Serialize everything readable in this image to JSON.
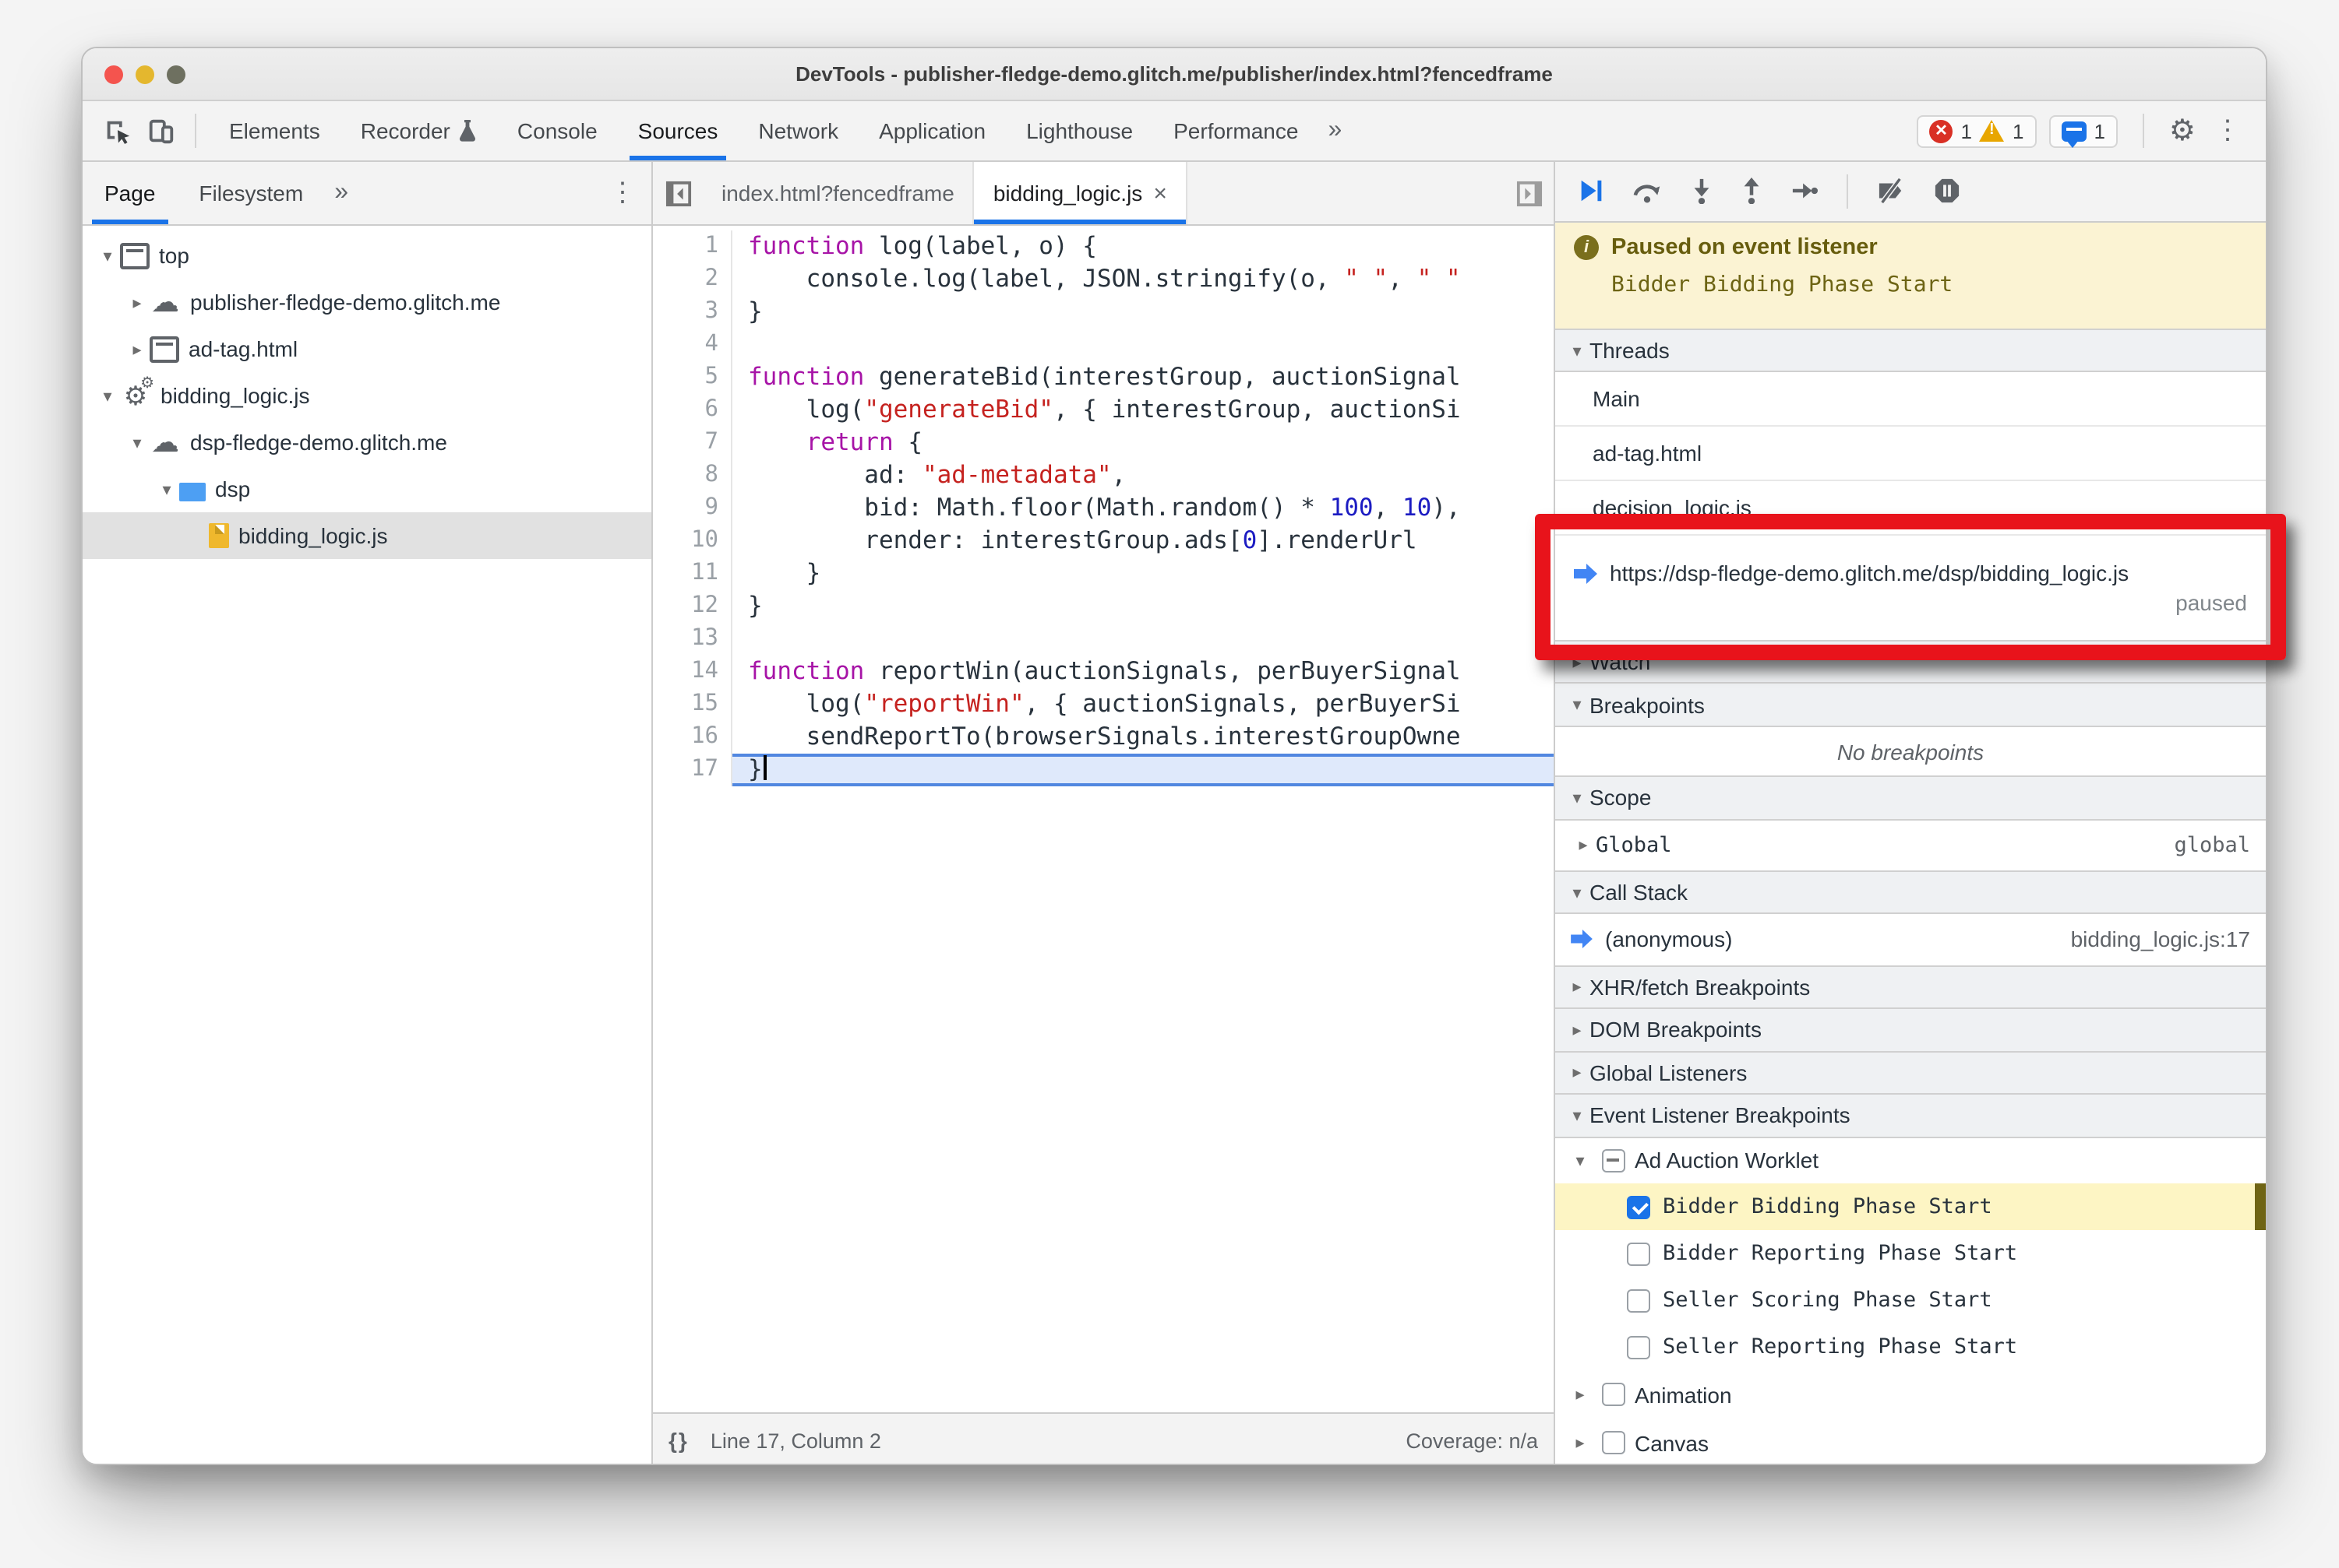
{
  "window": {
    "title": "DevTools - publisher-fledge-demo.glitch.me/publisher/index.html?fencedframe"
  },
  "toolbar": {
    "selected": "Sources",
    "tabs": [
      {
        "label": "Elements"
      },
      {
        "label": "Recorder",
        "icon": "flask"
      },
      {
        "label": "Console"
      },
      {
        "label": "Sources"
      },
      {
        "label": "Network"
      },
      {
        "label": "Application"
      },
      {
        "label": "Lighthouse"
      },
      {
        "label": "Performance"
      }
    ],
    "overflow": "»",
    "badges": {
      "errors": "1",
      "warnings": "1",
      "messages": "1"
    },
    "kebab": "⋮"
  },
  "navigator": {
    "tabs": [
      {
        "label": "Page"
      },
      {
        "label": "Filesystem"
      }
    ],
    "selected": "Page",
    "overflow": "»",
    "kebab": "⋮",
    "tree": [
      {
        "indent": 0,
        "disclosure": "down",
        "icon": "frame",
        "label": "top"
      },
      {
        "indent": 1,
        "disclosure": "right",
        "icon": "cloud",
        "label": "publisher-fledge-demo.glitch.me"
      },
      {
        "indent": 1,
        "disclosure": "right",
        "icon": "frame",
        "label": "ad-tag.html"
      },
      {
        "indent": 0,
        "disclosure": "down",
        "icon": "gears",
        "label": "bidding_logic.js"
      },
      {
        "indent": 1,
        "disclosure": "down",
        "icon": "cloud",
        "label": "dsp-fledge-demo.glitch.me"
      },
      {
        "indent": 2,
        "disclosure": "down",
        "icon": "folder",
        "label": "dsp"
      },
      {
        "indent": 3,
        "disclosure": "none",
        "icon": "file",
        "label": "bidding_logic.js",
        "selected": true
      }
    ]
  },
  "editor": {
    "tabs": [
      {
        "label": "index.html?fencedframe",
        "active": false
      },
      {
        "label": "bidding_logic.js",
        "active": true,
        "close": "×"
      }
    ],
    "lines": [
      {
        "n": 1,
        "t": [
          [
            "k",
            "function"
          ],
          [
            "p",
            " log(label, o) {"
          ]
        ]
      },
      {
        "n": 2,
        "t": [
          [
            "p",
            "    console.log(label, JSON.stringify(o, "
          ],
          [
            "s",
            "\" \""
          ],
          [
            "p",
            ", "
          ],
          [
            "s",
            "\" \""
          ]
        ]
      },
      {
        "n": 3,
        "t": [
          [
            "p",
            "}"
          ]
        ]
      },
      {
        "n": 4,
        "t": []
      },
      {
        "n": 5,
        "t": [
          [
            "k",
            "function"
          ],
          [
            "p",
            " generateBid(interestGroup, auctionSignal"
          ]
        ]
      },
      {
        "n": 6,
        "t": [
          [
            "p",
            "    log("
          ],
          [
            "s",
            "\"generateBid\""
          ],
          [
            "p",
            ", { interestGroup, auctionSi"
          ]
        ]
      },
      {
        "n": 7,
        "t": [
          [
            "p",
            "    "
          ],
          [
            "k",
            "return"
          ],
          [
            "p",
            " {"
          ]
        ]
      },
      {
        "n": 8,
        "t": [
          [
            "p",
            "        ad: "
          ],
          [
            "s",
            "\"ad-metadata\""
          ],
          [
            "p",
            ","
          ]
        ]
      },
      {
        "n": 9,
        "t": [
          [
            "p",
            "        bid: Math.floor(Math.random() * "
          ],
          [
            "n2",
            "100"
          ],
          [
            "p",
            ", "
          ],
          [
            "n2",
            "10"
          ],
          [
            "p",
            "),"
          ]
        ]
      },
      {
        "n": 10,
        "t": [
          [
            "p",
            "        render: interestGroup.ads["
          ],
          [
            "n2",
            "0"
          ],
          [
            "p",
            "].renderUrl"
          ]
        ]
      },
      {
        "n": 11,
        "t": [
          [
            "p",
            "    }"
          ]
        ]
      },
      {
        "n": 12,
        "t": [
          [
            "p",
            "}"
          ]
        ]
      },
      {
        "n": 13,
        "t": []
      },
      {
        "n": 14,
        "t": [
          [
            "k",
            "function"
          ],
          [
            "p",
            " reportWin(auctionSignals, perBuyerSignal"
          ]
        ]
      },
      {
        "n": 15,
        "t": [
          [
            "p",
            "    log("
          ],
          [
            "s",
            "\"reportWin\""
          ],
          [
            "p",
            ", { auctionSignals, perBuyerSi"
          ]
        ]
      },
      {
        "n": 16,
        "t": [
          [
            "p",
            "    sendReportTo(browserSignals.interestGroupOwne"
          ]
        ]
      },
      {
        "n": 17,
        "t": [
          [
            "p",
            "}"
          ]
        ],
        "hl": true,
        "caret": true
      }
    ],
    "status": {
      "position": "Line 17, Column 2",
      "coverage": "Coverage: n/a",
      "braces": "{}"
    }
  },
  "debugger": {
    "banner": {
      "title": "Paused on event listener",
      "subtitle": "Bidder Bidding Phase Start"
    },
    "sections": {
      "threads": "Threads",
      "watch": "Watch",
      "breakpoints": "Breakpoints",
      "scope": "Scope",
      "call_stack": "Call Stack",
      "xhr": "XHR/fetch Breakpoints",
      "dom": "DOM Breakpoints",
      "global_listeners": "Global Listeners",
      "event_listener_breakpoints": "Event Listener Breakpoints"
    },
    "threads": [
      "Main",
      "ad-tag.html",
      "decision_logic.js"
    ],
    "current_thread": {
      "url": "https://dsp-fledge-demo.glitch.me/dsp/bidding_logic.js",
      "status": "paused"
    },
    "breakpoints_empty": "No breakpoints",
    "scope": {
      "name": "Global",
      "value": "global"
    },
    "call_stack": {
      "fn": "(anonymous)",
      "loc": "bidding_logic.js:17"
    },
    "event_breakpoints": {
      "group": "Ad Auction Worklet",
      "items": [
        {
          "label": "Bidder Bidding Phase Start",
          "checked": true,
          "highlight": true
        },
        {
          "label": "Bidder Reporting Phase Start",
          "checked": false
        },
        {
          "label": "Seller Scoring Phase Start",
          "checked": false
        },
        {
          "label": "Seller Reporting Phase Start",
          "checked": false
        }
      ],
      "more": [
        {
          "label": "Animation"
        },
        {
          "label": "Canvas"
        }
      ]
    }
  }
}
